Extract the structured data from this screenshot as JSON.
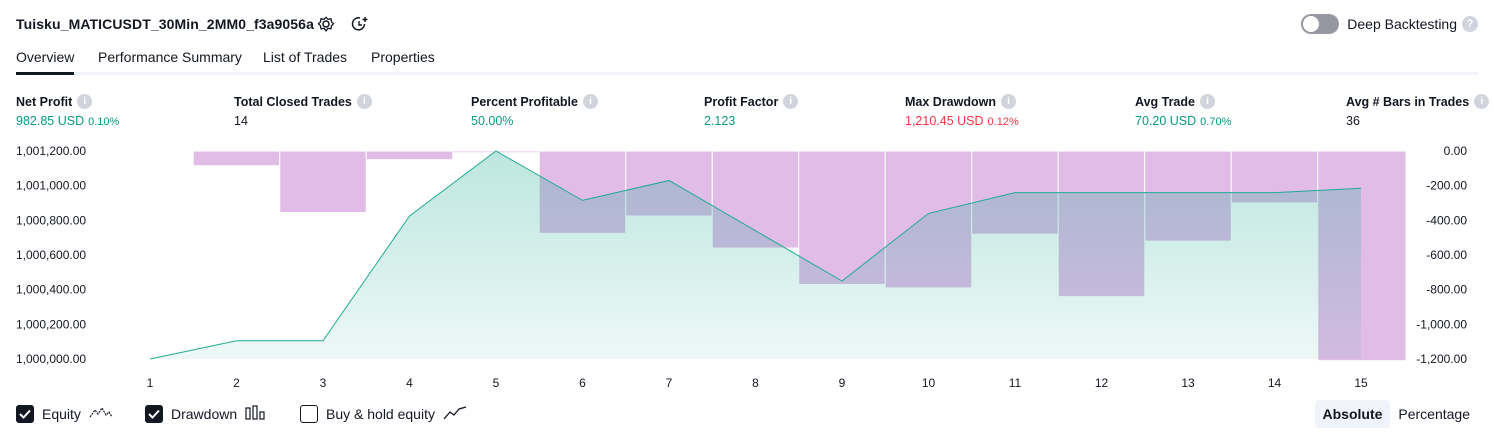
{
  "header": {
    "title": "Tuisku_MATICUSDT_30Min_2MM0_f3a9056a",
    "deep_backtesting_label": "Deep Backtesting",
    "deep_backtesting_on": false
  },
  "tabs": [
    {
      "label": "Overview",
      "active": true
    },
    {
      "label": "Performance Summary",
      "active": false
    },
    {
      "label": "List of Trades",
      "active": false
    },
    {
      "label": "Properties",
      "active": false
    }
  ],
  "metrics": [
    {
      "label": "Net Profit",
      "value": "982.85 USD",
      "pct": "0.10%",
      "color": "#089981"
    },
    {
      "label": "Total Closed Trades",
      "value": "14",
      "pct": "",
      "color": "#131722"
    },
    {
      "label": "Percent Profitable",
      "value": "50.00%",
      "pct": "",
      "color": "#089981"
    },
    {
      "label": "Profit Factor",
      "value": "2.123",
      "pct": "",
      "color": "#089981"
    },
    {
      "label": "Max Drawdown",
      "value": "1,210.45 USD",
      "pct": "0.12%",
      "color": "#f23645"
    },
    {
      "label": "Avg Trade",
      "value": "70.20 USD",
      "pct": "0.70%",
      "color": "#089981"
    },
    {
      "label": "Avg # Bars in Trades",
      "value": "36",
      "pct": "",
      "color": "#131722"
    }
  ],
  "chart_data": {
    "type": "area",
    "x": [
      1,
      2,
      3,
      4,
      5,
      6,
      7,
      8,
      9,
      10,
      11,
      12,
      13,
      14,
      15
    ],
    "x_tick_labels": [
      "1",
      "2",
      "3",
      "4",
      "5",
      "6",
      "7",
      "8",
      "9",
      "10",
      "11",
      "12",
      "13",
      "14",
      "15"
    ],
    "y_left_ticks": [
      "1,001,200.00",
      "1,001,000.00",
      "1,000,800.00",
      "1,000,600.00",
      "1,000,400.00",
      "1,000,200.00",
      "1,000,000.00"
    ],
    "y_left_tick_values": [
      1001200,
      1001000,
      1000800,
      1000600,
      1000400,
      1000200,
      1000000
    ],
    "y_right_ticks": [
      "0.00",
      "-200.00",
      "-400.00",
      "-600.00",
      "-800.00",
      "-1,000.00",
      "-1,200.00"
    ],
    "y_right_tick_values": [
      0,
      -200,
      -400,
      -600,
      -800,
      -1000,
      -1200
    ],
    "ylim_left": [
      1000000,
      1001200
    ],
    "ylim_right": [
      -1200,
      0
    ],
    "series": [
      {
        "name": "Equity",
        "axis": "left",
        "type": "area",
        "color": "#22ab94",
        "values": [
          1000000,
          1000105,
          1000105,
          1000825,
          1001200,
          1000915,
          1001030,
          null,
          1000450,
          1000840,
          1000960,
          1000960,
          1000960,
          1000960,
          1000985
        ]
      },
      {
        "name": "Drawdown",
        "axis": "right",
        "type": "bar",
        "color": "#ce93d8",
        "values": [
          -5,
          -85,
          -355,
          -50,
          -10,
          -475,
          -375,
          -560,
          -770,
          -790,
          -480,
          -840,
          -520,
          -300,
          -1210
        ]
      }
    ],
    "grid": false
  },
  "legend": {
    "equity_label": "Equity",
    "equity_checked": true,
    "drawdown_label": "Drawdown",
    "drawdown_checked": true,
    "buyhold_label": "Buy & hold equity",
    "buyhold_checked": false
  },
  "scale_toggle": {
    "absolute_label": "Absolute",
    "percentage_label": "Percentage",
    "selected": "Absolute"
  }
}
